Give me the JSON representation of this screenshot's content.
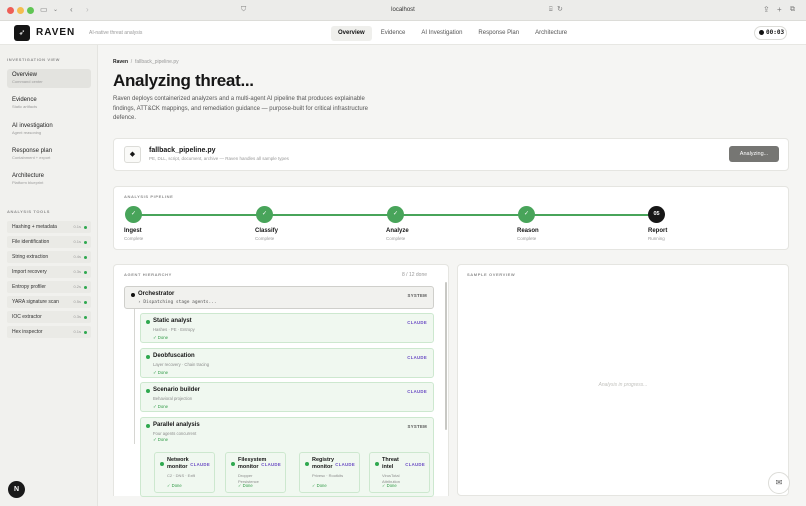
{
  "browser": {
    "url": "localhost",
    "icons": [
      "sidebar-toggle-icon",
      "back-icon",
      "forward-icon",
      "shield-icon",
      "translate-icon",
      "reload-icon",
      "share-icon",
      "new-tab-icon",
      "tabs-icon"
    ]
  },
  "app": {
    "brand": "RAVEN",
    "tagline": "AI-native threat analysis",
    "nav": [
      {
        "label": "Overview",
        "active": true
      },
      {
        "label": "Evidence"
      },
      {
        "label": "AI Investigation"
      },
      {
        "label": "Response Plan"
      },
      {
        "label": "Architecture"
      }
    ],
    "timer": "00:03"
  },
  "sidebar": {
    "view_label": "INVESTIGATION VIEW",
    "views": [
      {
        "title": "Overview",
        "sub": "Command center",
        "active": true
      },
      {
        "title": "Evidence",
        "sub": "Static artifacts"
      },
      {
        "title": "AI investigation",
        "sub": "Agent reasoning"
      },
      {
        "title": "Response plan",
        "sub": "Containment + export"
      },
      {
        "title": "Architecture",
        "sub": "Platform blueprint"
      }
    ],
    "tools_label": "ANALYSIS TOOLS",
    "tools": [
      {
        "name": "Hashing + metadata",
        "time": "0.1s"
      },
      {
        "name": "File identification",
        "time": "0.1s"
      },
      {
        "name": "String extraction",
        "time": "0.4s"
      },
      {
        "name": "Import recovery",
        "time": "0.3s"
      },
      {
        "name": "Entropy profiler",
        "time": "0.2s"
      },
      {
        "name": "YARA signature scan",
        "time": "0.5s"
      },
      {
        "name": "IOC extractor",
        "time": "0.3s"
      },
      {
        "name": "Hex inspector",
        "time": "0.1s"
      }
    ],
    "avatar": "N"
  },
  "main": {
    "breadcrumb": {
      "root": "Raven",
      "sep": "/",
      "file": "fallback_pipeline.py"
    },
    "title": "Analyzing threat...",
    "description": "Raven deploys containerized analyzers and a multi-agent AI pipeline that produces explainable findings, ATT&CK mappings, and remediation guidance — purpose-built for critical infrastructure defence.",
    "file": {
      "name": "fallback_pipeline.py",
      "sub": "PE, DLL, script, document, archive — Raven handles all sample types",
      "button": "Analyzing..."
    },
    "pipeline": {
      "label": "ANALYSIS PIPELINE",
      "steps": [
        {
          "name": "Ingest",
          "status": "Complete",
          "mark": "✓"
        },
        {
          "name": "Classify",
          "status": "Complete",
          "mark": "✓"
        },
        {
          "name": "Analyze",
          "status": "Complete",
          "mark": "✓"
        },
        {
          "name": "Reason",
          "status": "Complete",
          "mark": "✓"
        },
        {
          "name": "Report",
          "status": "Running",
          "mark": "05"
        }
      ]
    },
    "hierarchy": {
      "label": "AGENT HIERARCHY",
      "count": "8 / 12 done",
      "orchestrator": {
        "name": "Orchestrator",
        "tag": "SYSTEM",
        "status": "› Dispatching stage agents..."
      },
      "agents": [
        {
          "name": "Static analyst",
          "sub": "Hashes · PE · Entropy",
          "tag": "CLAUDE",
          "status": "✓ Done"
        },
        {
          "name": "Deobfuscation",
          "sub": "Layer recovery · Chain tracing",
          "tag": "CLAUDE",
          "status": "✓ Done"
        },
        {
          "name": "Scenario builder",
          "sub": "Behavioral projection",
          "tag": "CLAUDE",
          "status": "✓ Done"
        },
        {
          "name": "Parallel analysis",
          "sub": "Four agents concurrent",
          "tag": "SYSTEM",
          "status": "✓ Done"
        }
      ],
      "subagents": [
        {
          "name": "Network monitor",
          "sub": "C2 · DNS · Exfil",
          "tag": "CLAUDE",
          "status": "✓ Done"
        },
        {
          "name": "Filesystem monitor",
          "sub": "Dropper Persistence",
          "tag": "CLAUDE",
          "status": "✓ Done"
        },
        {
          "name": "Registry monitor",
          "sub": "Privesc · Rootkits",
          "tag": "CLAUDE",
          "status": "✓ Done"
        },
        {
          "name": "Threat intel",
          "sub": "VirusTotal Attribution",
          "tag": "CLAUDE",
          "status": "✓ Done"
        }
      ]
    },
    "overview": {
      "label": "SAMPLE OVERVIEW",
      "placeholder": "Analysis in progress..."
    }
  },
  "colors": {
    "accent": "#171717",
    "success": "#48a45a",
    "claude": "#6a4bc4",
    "button": "#767673"
  }
}
